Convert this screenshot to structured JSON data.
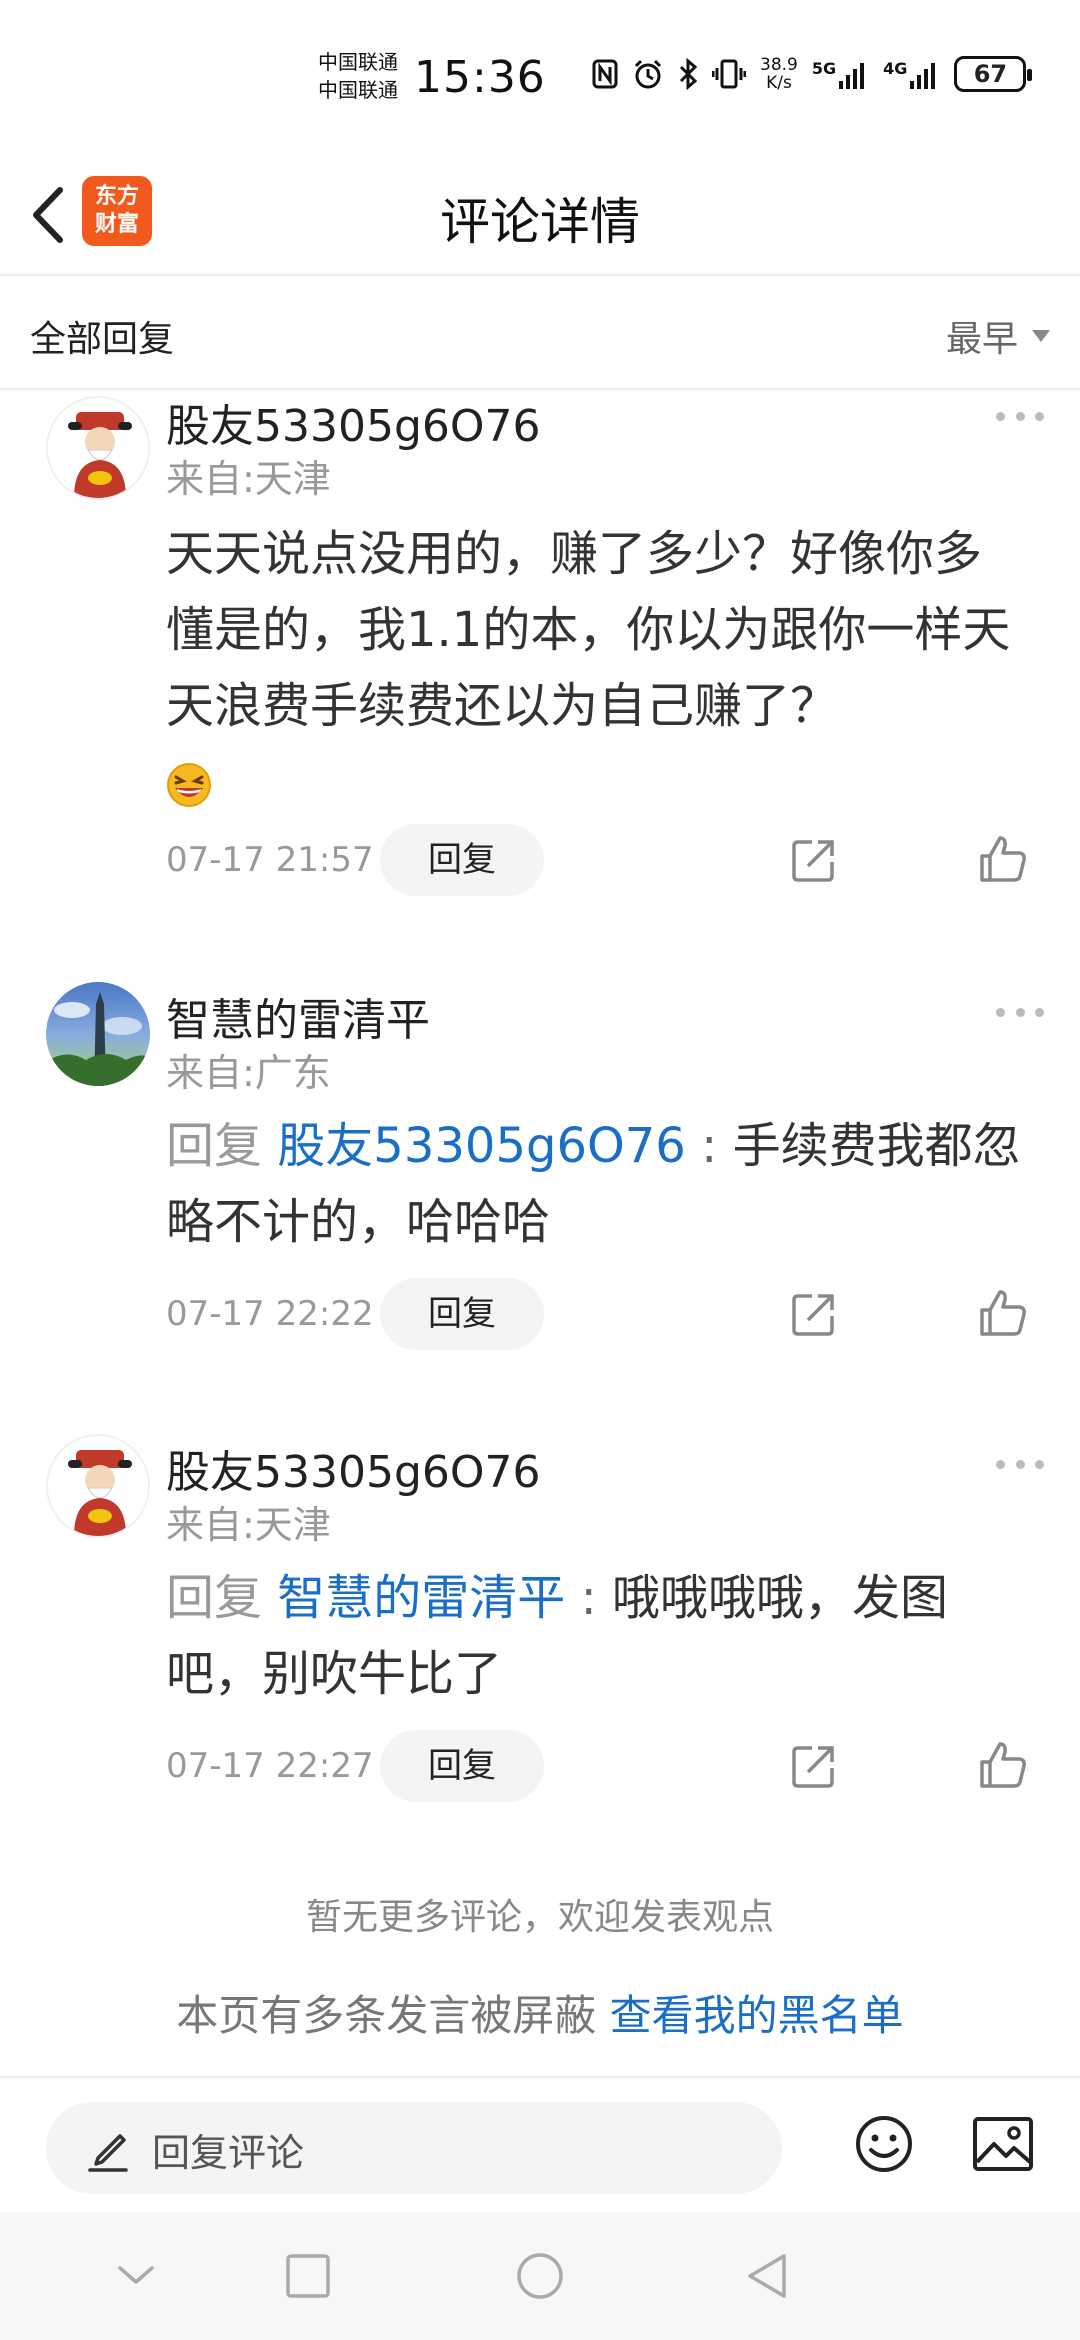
{
  "status_bar": {
    "carrier_1": "中国联通",
    "carrier_2": "中国联通",
    "time": "15:36",
    "speed_value": "38.9",
    "speed_unit": "K/s",
    "net_1": "5G",
    "net_2": "4G",
    "battery": "67"
  },
  "header": {
    "logo_line1": "东方",
    "logo_line2": "财富",
    "title": "评论详情"
  },
  "filter": {
    "label": "全部回复",
    "sort": "最早"
  },
  "comments": [
    {
      "user": "股友53305g6O76",
      "location": "来自:天津",
      "text": "天天说点没用的，赚了多少？好像你多懂是的，我1.1的本，你以为跟你一样天天浪费手续费还以为自己赚了？",
      "time": "07-17 21:57",
      "reply_label": "回复"
    },
    {
      "user": "智慧的雷清平",
      "location": "来自:广东",
      "reply_prefix": "回复",
      "mention": "股友53305g6O76",
      "colon": ":",
      "text": "手续费我都忽略不计的，哈哈哈",
      "time": "07-17 22:22",
      "reply_label": "回复"
    },
    {
      "user": "股友53305g6O76",
      "location": "来自:天津",
      "reply_prefix": "回复",
      "mention": "智慧的雷清平",
      "colon": ":",
      "text": "哦哦哦哦，发图吧，别吹牛比了",
      "time": "07-17 22:27",
      "reply_label": "回复"
    }
  ],
  "footer": {
    "no_more": "暂无更多评论，欢迎发表观点",
    "blocked_text": "本页有多条发言被屏蔽",
    "blacklist_link": "查看我的黑名单"
  },
  "input_bar": {
    "placeholder": "回复评论"
  },
  "icons": {
    "back": "back-arrow-icon",
    "more": "more-dots-icon",
    "share": "share-icon",
    "like": "thumbs-up-icon",
    "laugh": "laughing-emoji-icon",
    "pencil": "pencil-icon",
    "emoji": "emoji-icon",
    "image": "image-icon"
  },
  "colors": {
    "brand": "#f25a1d",
    "link": "#1a6ec8"
  }
}
